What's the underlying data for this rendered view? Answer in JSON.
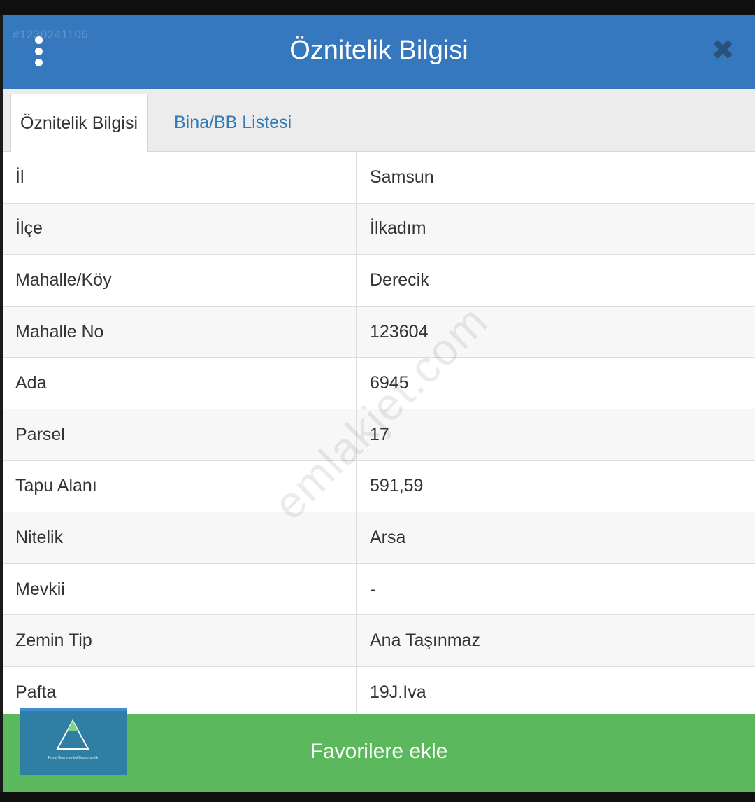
{
  "dialog": {
    "title": "Öznitelik Bilgisi",
    "listing_id": "#1230241106",
    "close_symbol": "✖"
  },
  "tabs": [
    {
      "label": "Öznitelik Bilgisi",
      "active": true
    },
    {
      "label": "Bina/BB Listesi",
      "active": false
    }
  ],
  "attributes": [
    {
      "key": "İl",
      "value": "Samsun"
    },
    {
      "key": "İlçe",
      "value": "İlkadım"
    },
    {
      "key": "Mahalle/Köy",
      "value": "Derecik"
    },
    {
      "key": "Mahalle No",
      "value": "123604"
    },
    {
      "key": "Ada",
      "value": "6945"
    },
    {
      "key": "Parsel",
      "value": "17"
    },
    {
      "key": "Tapu Alanı",
      "value": "591,59"
    },
    {
      "key": "Nitelik",
      "value": "Arsa"
    },
    {
      "key": "Mevkii",
      "value": "-"
    },
    {
      "key": "Zemin Tip",
      "value": "Ana Taşınmaz"
    },
    {
      "key": "Pafta",
      "value": "19J.Iva"
    }
  ],
  "watermark": "emlakjet.com",
  "footer": {
    "favorite_label": "Favorilere ekle",
    "logo_caption": "Royal Gayrimenkul Danışmanlık"
  },
  "colors": {
    "header": "#3578be",
    "favorite_bar": "#5cb85c",
    "tab_link": "#337ab7"
  },
  "icons": {
    "menu": "vertical-ellipsis-icon",
    "close": "close-icon",
    "logo": "triangle-logo-icon"
  }
}
